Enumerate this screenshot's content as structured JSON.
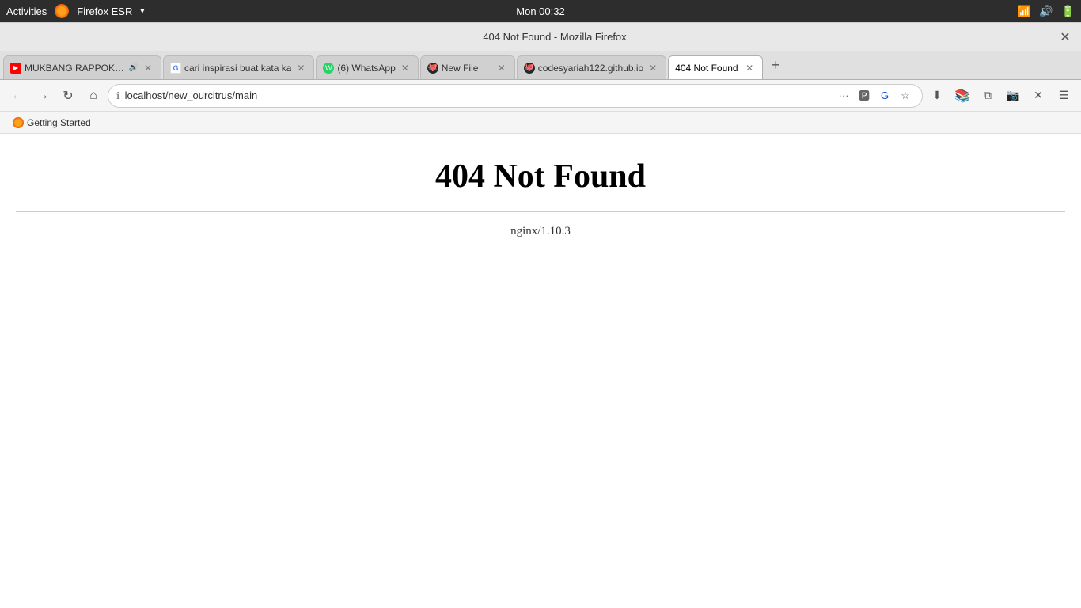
{
  "os": {
    "taskbar": {
      "activities_label": "Activities",
      "browser_label": "Firefox ESR",
      "time": "Mon 00:32"
    }
  },
  "browser": {
    "title": "404 Not Found - Mozilla Firefox",
    "tabs": [
      {
        "id": "tab-1",
        "label": "MUKBANG RAPPOKI M",
        "favicon": "yt",
        "has_audio": true,
        "active": false
      },
      {
        "id": "tab-2",
        "label": "cari inspirasi buat kata ka",
        "favicon": "g",
        "has_audio": false,
        "active": false
      },
      {
        "id": "tab-3",
        "label": "(6) WhatsApp",
        "favicon": "wa",
        "has_audio": false,
        "active": false
      },
      {
        "id": "tab-4",
        "label": "New File",
        "favicon": "gh",
        "has_audio": false,
        "active": false
      },
      {
        "id": "tab-5",
        "label": "codesyariah122.github.io",
        "favicon": "gh2",
        "has_audio": false,
        "active": false
      },
      {
        "id": "tab-6",
        "label": "404 Not Found",
        "favicon": "none",
        "has_audio": false,
        "active": true
      }
    ],
    "url": "localhost/new_ourcitrus/main",
    "url_protocol": "localhost",
    "bookmarks": [
      {
        "label": "Getting Started",
        "favicon": "ff"
      }
    ]
  },
  "page": {
    "error_title": "404 Not Found",
    "server_info": "nginx/1.10.3"
  }
}
